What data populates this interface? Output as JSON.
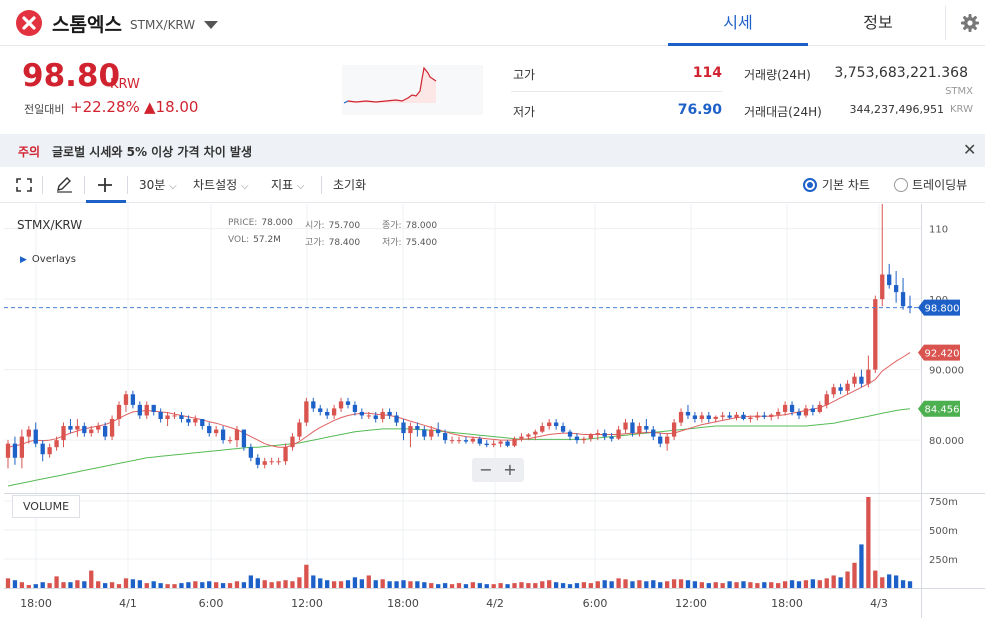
{
  "header": {
    "coin_name": "스톰엑스",
    "pair": "STMX/KRW",
    "tabs": [
      {
        "label": "시세",
        "active": true
      },
      {
        "label": "정보",
        "active": false
      }
    ]
  },
  "summary": {
    "price": "98.80",
    "unit": "KRW",
    "change_label": "전일대비",
    "change_pct": "+22.28%",
    "change_abs": "▲18.00",
    "high_label": "고가",
    "high_value": "114",
    "low_label": "저가",
    "low_value": "76.90",
    "volume_label": "거래량(24H)",
    "volume_value": "3,753,683,221.368",
    "volume_unit": "STMX",
    "amount_label": "거래대금(24H)",
    "amount_value": "344,237,496,951",
    "amount_unit": "KRW"
  },
  "notice": {
    "tag": "주의",
    "text": "글로벌 시세와 5% 이상 가격 차이 발생",
    "close": "✕"
  },
  "toolbar": {
    "interval": "30분",
    "chart_settings": "차트설정",
    "indicators": "지표",
    "reset": "초기화",
    "basic_chart": "기본 차트",
    "tradingview": "트레이딩뷰"
  },
  "chart_panel": {
    "symbol": "STMX/KRW",
    "overlays": "Overlays",
    "volume_label": "VOLUME",
    "ohlc": {
      "price_k": "PRICE:",
      "price_v": "78.000",
      "open_k": "시가:",
      "open_v": "75.700",
      "close_k": "종가:",
      "close_v": "78.000",
      "vol_k": "VOL:",
      "vol_v": "57.2M",
      "high_k": "고가:",
      "high_v": "78.400",
      "low_k": "저가:",
      "low_v": "75.400"
    },
    "zoom_out": "−",
    "zoom_in": "+"
  },
  "colors": {
    "up": "#d9534f",
    "down": "#1d61c8",
    "ma_short": "#e06060",
    "ma_long": "#55bb55",
    "accent": "#1d61c8"
  },
  "chart_data": {
    "type": "candlestick",
    "x_tick_labels": [
      "18:00",
      "4/1",
      "6:00",
      "12:00",
      "18:00",
      "4/2",
      "6:00",
      "12:00",
      "18:00",
      "4/3"
    ],
    "y_tick_labels": [
      "110",
      "100",
      "90.000",
      "80.000"
    ],
    "volume_tick_labels": [
      "750m",
      "500m",
      "250m"
    ],
    "ylim": [
      72.5,
      113.5
    ],
    "volume_max": 800,
    "current_price_label": "98.800",
    "current_price": 98.8,
    "ma_short_label": "92.420",
    "ma_short_last": 92.42,
    "ma_long_label": "84.456",
    "ma_long_last": 84.456,
    "candles": [
      [
        77.5,
        80.0,
        76.0,
        79.5
      ],
      [
        79.5,
        80.5,
        76.5,
        77.5
      ],
      [
        77.5,
        81.5,
        76.0,
        80.5
      ],
      [
        80.5,
        82.0,
        79.5,
        81.5
      ],
      [
        81.5,
        82.5,
        79.0,
        79.5
      ],
      [
        79.5,
        80.0,
        77.0,
        78.0
      ],
      [
        78.0,
        79.5,
        77.5,
        79.0
      ],
      [
        79.0,
        80.5,
        78.5,
        80.0
      ],
      [
        80.0,
        82.5,
        79.0,
        82.0
      ],
      [
        82.0,
        83.0,
        81.0,
        81.5
      ],
      [
        81.5,
        83.0,
        80.5,
        82.0
      ],
      [
        82.0,
        82.5,
        80.5,
        81.0
      ],
      [
        81.0,
        82.0,
        80.5,
        81.5
      ],
      [
        81.5,
        82.5,
        81.0,
        82.0
      ],
      [
        82.0,
        82.5,
        80.0,
        80.5
      ],
      [
        80.5,
        83.5,
        80.0,
        83.0
      ],
      [
        83.0,
        85.5,
        82.0,
        85.0
      ],
      [
        85.0,
        87.0,
        84.0,
        86.5
      ],
      [
        86.5,
        87.0,
        84.5,
        85.0
      ],
      [
        85.0,
        85.5,
        83.0,
        83.5
      ],
      [
        83.5,
        85.5,
        83.0,
        85.0
      ],
      [
        85.0,
        85.0,
        83.5,
        84.0
      ],
      [
        84.0,
        84.5,
        82.5,
        83.0
      ],
      [
        83.0,
        84.0,
        82.0,
        83.5
      ],
      [
        83.5,
        84.0,
        83.0,
        83.5
      ],
      [
        83.5,
        84.0,
        82.5,
        83.0
      ],
      [
        83.0,
        83.5,
        82.0,
        82.5
      ],
      [
        82.5,
        83.5,
        82.0,
        83.0
      ],
      [
        83.0,
        83.0,
        81.5,
        82.0
      ],
      [
        82.0,
        82.5,
        80.5,
        81.0
      ],
      [
        81.0,
        82.0,
        80.5,
        81.5
      ],
      [
        81.5,
        82.0,
        79.5,
        80.0
      ],
      [
        80.0,
        80.5,
        79.5,
        80.0
      ],
      [
        80.0,
        82.0,
        79.0,
        81.5
      ],
      [
        81.5,
        81.5,
        78.5,
        79.0
      ],
      [
        79.0,
        79.5,
        77.0,
        77.5
      ],
      [
        77.5,
        78.0,
        76.0,
        76.5
      ],
      [
        76.5,
        77.5,
        76.0,
        77.0
      ],
      [
        77.0,
        77.5,
        76.5,
        77.0
      ],
      [
        77.0,
        77.5,
        76.5,
        77.0
      ],
      [
        77.0,
        79.5,
        76.5,
        79.0
      ],
      [
        79.0,
        81.0,
        78.5,
        80.5
      ],
      [
        80.5,
        83.0,
        80.0,
        82.5
      ],
      [
        82.5,
        86.0,
        82.0,
        85.5
      ],
      [
        85.5,
        86.0,
        84.0,
        84.5
      ],
      [
        84.5,
        85.0,
        83.5,
        84.0
      ],
      [
        84.0,
        84.5,
        83.0,
        83.5
      ],
      [
        83.5,
        85.0,
        83.0,
        84.5
      ],
      [
        84.5,
        86.0,
        84.0,
        85.5
      ],
      [
        85.5,
        86.0,
        84.5,
        85.0
      ],
      [
        85.0,
        85.5,
        83.5,
        84.0
      ],
      [
        84.0,
        84.5,
        83.0,
        83.5
      ],
      [
        83.5,
        84.0,
        83.0,
        83.5
      ],
      [
        83.5,
        84.0,
        82.5,
        83.0
      ],
      [
        83.0,
        84.5,
        82.5,
        84.0
      ],
      [
        84.0,
        84.5,
        83.0,
        83.5
      ],
      [
        83.5,
        84.0,
        82.0,
        82.5
      ],
      [
        82.5,
        83.0,
        80.0,
        81.0
      ],
      [
        81.0,
        82.5,
        79.0,
        82.0
      ],
      [
        82.0,
        82.5,
        80.5,
        81.5
      ],
      [
        81.5,
        82.0,
        80.0,
        80.5
      ],
      [
        80.5,
        82.0,
        80.0,
        81.5
      ],
      [
        81.5,
        82.5,
        80.5,
        81.0
      ],
      [
        81.0,
        81.5,
        79.5,
        80.0
      ],
      [
        80.0,
        80.5,
        79.5,
        80.0
      ],
      [
        80.0,
        80.5,
        79.5,
        80.0
      ],
      [
        80.0,
        80.5,
        79.5,
        79.8
      ],
      [
        79.8,
        80.5,
        79.5,
        80.2
      ],
      [
        80.2,
        80.5,
        79.2,
        79.5
      ],
      [
        79.5,
        80.0,
        79.0,
        79.3
      ],
      [
        79.3,
        80.0,
        79.0,
        79.5
      ],
      [
        79.5,
        80.0,
        79.0,
        79.8
      ],
      [
        79.8,
        80.0,
        79.0,
        79.2
      ],
      [
        79.2,
        80.5,
        79.0,
        80.2
      ],
      [
        80.2,
        81.0,
        79.8,
        80.5
      ],
      [
        80.5,
        81.0,
        80.0,
        80.8
      ],
      [
        80.8,
        81.5,
        80.0,
        81.2
      ],
      [
        81.2,
        82.5,
        81.0,
        82.0
      ],
      [
        82.0,
        83.0,
        81.5,
        82.5
      ],
      [
        82.5,
        83.0,
        81.5,
        82.0
      ],
      [
        82.0,
        82.5,
        81.0,
        81.2
      ],
      [
        81.2,
        81.5,
        80.0,
        80.5
      ],
      [
        80.5,
        81.0,
        79.5,
        80.0
      ],
      [
        80.0,
        80.5,
        79.5,
        80.2
      ],
      [
        80.2,
        81.0,
        79.8,
        80.8
      ],
      [
        80.8,
        81.5,
        80.0,
        81.0
      ],
      [
        81.0,
        81.5,
        80.0,
        80.5
      ],
      [
        80.5,
        81.0,
        79.8,
        80.2
      ],
      [
        80.2,
        82.0,
        80.0,
        81.5
      ],
      [
        81.5,
        83.0,
        81.0,
        82.5
      ],
      [
        82.5,
        83.0,
        80.5,
        81.0
      ],
      [
        81.0,
        82.5,
        80.5,
        82.0
      ],
      [
        82.0,
        83.0,
        81.0,
        81.5
      ],
      [
        81.5,
        82.0,
        80.0,
        80.5
      ],
      [
        80.5,
        81.0,
        79.0,
        79.5
      ],
      [
        79.5,
        81.0,
        78.5,
        80.5
      ],
      [
        80.5,
        83.0,
        80.0,
        82.5
      ],
      [
        82.5,
        84.5,
        82.0,
        84.0
      ],
      [
        84.0,
        85.0,
        83.0,
        83.5
      ],
      [
        83.5,
        84.0,
        82.5,
        83.0
      ],
      [
        83.0,
        84.0,
        82.5,
        83.5
      ],
      [
        83.5,
        84.0,
        82.5,
        83.0
      ],
      [
        83.0,
        83.5,
        82.5,
        83.3
      ],
      [
        83.3,
        84.0,
        82.8,
        83.5
      ],
      [
        83.5,
        84.0,
        83.0,
        83.2
      ],
      [
        83.2,
        84.0,
        82.8,
        83.6
      ],
      [
        83.6,
        84.0,
        82.8,
        83.0
      ],
      [
        83.0,
        83.5,
        82.5,
        83.2
      ],
      [
        83.2,
        84.0,
        82.8,
        83.5
      ],
      [
        83.5,
        84.0,
        83.0,
        83.3
      ],
      [
        83.3,
        83.8,
        82.8,
        83.6
      ],
      [
        83.6,
        84.5,
        83.0,
        84.0
      ],
      [
        84.0,
        85.5,
        83.5,
        85.0
      ],
      [
        85.0,
        85.5,
        83.5,
        84.0
      ],
      [
        84.0,
        84.5,
        83.0,
        83.5
      ],
      [
        83.5,
        85.0,
        83.2,
        84.5
      ],
      [
        84.5,
        85.0,
        83.5,
        84.0
      ],
      [
        84.0,
        85.5,
        83.8,
        85.0
      ],
      [
        85.0,
        87.0,
        84.5,
        86.5
      ],
      [
        86.5,
        88.0,
        86.0,
        87.5
      ],
      [
        87.5,
        88.0,
        86.5,
        87.0
      ],
      [
        87.0,
        88.5,
        86.5,
        88.0
      ],
      [
        88.0,
        89.5,
        87.5,
        89.0
      ],
      [
        89.0,
        90.0,
        87.5,
        88.0
      ],
      [
        88.0,
        92.0,
        87.5,
        90.0
      ],
      [
        90.0,
        100.5,
        89.5,
        100.0
      ],
      [
        100.0,
        114.0,
        99.0,
        103.5
      ],
      [
        103.5,
        105.0,
        101.5,
        102.0
      ],
      [
        102.0,
        104.0,
        99.5,
        101.0
      ],
      [
        101.0,
        103.0,
        98.5,
        99.0
      ],
      [
        99.0,
        100.5,
        98.0,
        98.8
      ]
    ],
    "volumes": [
      83,
      67,
      50,
      25,
      33,
      50,
      42,
      100,
      50,
      50,
      67,
      58,
      150,
      58,
      42,
      50,
      33,
      83,
      75,
      67,
      42,
      58,
      42,
      33,
      33,
      42,
      50,
      58,
      50,
      58,
      50,
      42,
      42,
      58,
      50,
      108,
      83,
      67,
      50,
      58,
      67,
      58,
      92,
      200,
      108,
      83,
      67,
      58,
      58,
      67,
      92,
      75,
      108,
      67,
      75,
      58,
      58,
      67,
      58,
      58,
      50,
      42,
      33,
      42,
      33,
      42,
      33,
      50,
      42,
      33,
      33,
      42,
      33,
      42,
      50,
      42,
      42,
      58,
      67,
      50,
      42,
      33,
      42,
      50,
      42,
      58,
      67,
      58,
      83,
      75,
      58,
      67,
      58,
      67,
      50,
      58,
      75,
      75,
      67,
      58,
      50,
      42,
      50,
      42,
      58,
      50,
      58,
      50,
      42,
      50,
      50,
      42,
      58,
      67,
      58,
      67,
      75,
      67,
      83,
      108,
      92,
      142,
      217,
      375,
      783,
      150,
      92,
      117,
      108,
      67,
      58
    ],
    "ma_short": [
      79.0,
      79.2,
      79.4,
      79.8,
      80.0,
      79.9,
      80.0,
      80.2,
      80.6,
      81.0,
      81.3,
      81.6,
      81.8,
      82.0,
      82.2,
      82.6,
      83.1,
      83.6,
      84.0,
      84.1,
      84.2,
      84.1,
      84.0,
      83.9,
      83.7,
      83.5,
      83.3,
      83.1,
      82.9,
      82.6,
      82.4,
      82.1,
      81.8,
      81.5,
      81.0,
      80.5,
      80.0,
      79.5,
      79.2,
      79.0,
      79.0,
      79.3,
      79.8,
      80.5,
      81.2,
      81.8,
      82.3,
      82.8,
      83.2,
      83.5,
      83.7,
      83.8,
      83.8,
      83.7,
      83.6,
      83.5,
      83.3,
      83.0,
      82.7,
      82.4,
      82.1,
      81.8,
      81.5,
      81.2,
      80.9,
      80.7,
      80.5,
      80.4,
      80.3,
      80.2,
      80.1,
      80.0,
      80.0,
      80.0,
      80.1,
      80.2,
      80.4,
      80.6,
      80.8,
      80.9,
      81.0,
      81.0,
      80.9,
      80.8,
      80.8,
      80.8,
      80.8,
      80.8,
      80.8,
      80.9,
      81.0,
      81.0,
      81.1,
      81.1,
      81.0,
      80.9,
      81.0,
      81.3,
      81.6,
      81.9,
      82.2,
      82.4,
      82.6,
      82.8,
      83.0,
      83.2,
      83.3,
      83.4,
      83.4,
      83.4,
      83.4,
      83.5,
      83.6,
      83.8,
      84.0,
      84.2,
      84.4,
      84.6,
      85.0,
      85.5,
      86.0,
      86.5,
      87.0,
      87.5,
      88.0,
      88.6,
      89.8,
      90.5,
      91.2,
      91.8,
      92.42
    ],
    "ma_long": [
      73.5,
      73.7,
      73.9,
      74.1,
      74.3,
      74.5,
      74.7,
      74.9,
      75.1,
      75.3,
      75.5,
      75.7,
      75.9,
      76.1,
      76.3,
      76.5,
      76.7,
      76.9,
      77.1,
      77.3,
      77.5,
      77.6,
      77.7,
      77.8,
      77.9,
      78.0,
      78.1,
      78.2,
      78.3,
      78.4,
      78.5,
      78.6,
      78.7,
      78.8,
      78.9,
      79.0,
      79.0,
      79.1,
      79.2,
      79.3,
      79.4,
      79.5,
      79.6,
      79.8,
      80.0,
      80.2,
      80.4,
      80.6,
      80.8,
      81.0,
      81.2,
      81.3,
      81.4,
      81.5,
      81.6,
      81.6,
      81.6,
      81.6,
      81.6,
      81.5,
      81.5,
      81.4,
      81.3,
      81.2,
      81.1,
      81.0,
      80.9,
      80.8,
      80.7,
      80.6,
      80.5,
      80.4,
      80.3,
      80.2,
      80.1,
      80.1,
      80.1,
      80.1,
      80.1,
      80.1,
      80.1,
      80.1,
      80.1,
      80.1,
      80.2,
      80.3,
      80.4,
      80.5,
      80.6,
      80.7,
      80.8,
      80.9,
      81.0,
      81.1,
      81.2,
      81.3,
      81.4,
      81.5,
      81.6,
      81.7,
      81.8,
      81.9,
      82.0,
      82.0,
      82.0,
      82.0,
      82.0,
      82.0,
      82.0,
      82.0,
      82.0,
      82.0,
      82.0,
      82.0,
      82.0,
      82.0,
      82.1,
      82.2,
      82.3,
      82.4,
      82.6,
      82.8,
      83.0,
      83.2,
      83.4,
      83.6,
      83.8,
      84.0,
      84.2,
      84.35,
      84.456
    ]
  }
}
